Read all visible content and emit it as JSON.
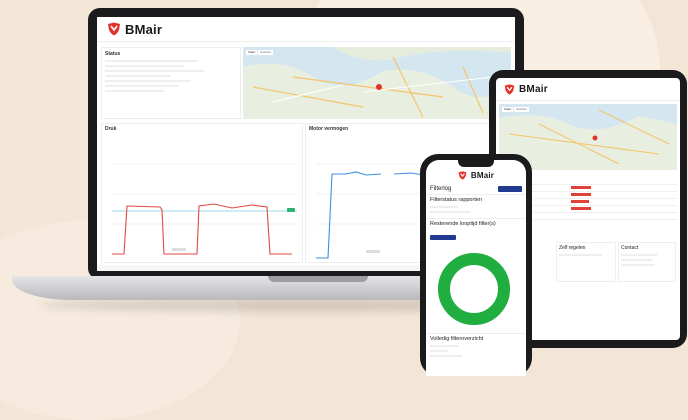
{
  "brand": {
    "name": "BMair",
    "accent": "#e2332b",
    "chart_red": "#e04a3f",
    "chart_blue": "#3c8fe0",
    "gauge_green": "#1fae3f",
    "button_blue": "#213a8f"
  },
  "laptop": {
    "status_title": "Status",
    "map_tabs": [
      "Kaart",
      "Satelliet"
    ],
    "chart_left_title": "Druk",
    "chart_right_title": "Motor vermogen"
  },
  "tablet": {
    "map_tabs": [
      "Kaart",
      "Satelliet"
    ],
    "card_titles": [
      "Zelf regelen",
      "Contact"
    ]
  },
  "phone": {
    "title": "Filterlog",
    "action_label": "",
    "sections": [
      "Filterstatus rapporten",
      "Resterende looptijd filter(s)",
      "Volledig filteroverzicht"
    ],
    "filter_remaining_fraction": 1.0
  }
}
